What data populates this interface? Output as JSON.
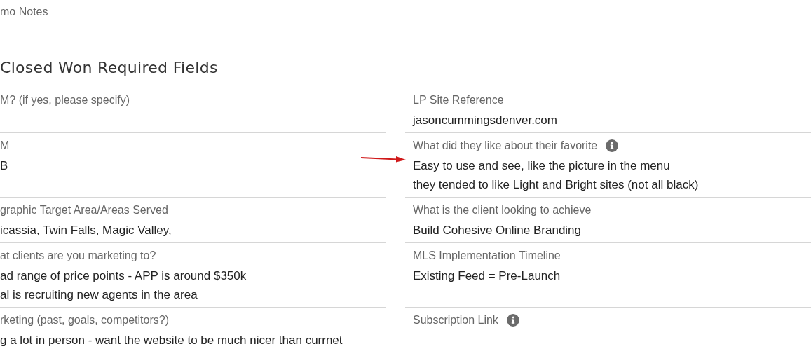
{
  "notes_section": {
    "label": "mo Notes"
  },
  "section_title": "Closed Won Required Fields",
  "rows": [
    {
      "left": {
        "label": "M? (if yes, please specify)"
      },
      "right": {
        "label": "LP Site Reference",
        "values": [
          "jasoncummingsdenver.com"
        ]
      }
    },
    {
      "left": {
        "label": "M",
        "values": [
          "B"
        ]
      },
      "right": {
        "label": "What did they like about their favorite",
        "values": [
          "Easy to use and see, like the picture in the menu",
          "they tended to like Light and Bright sites (not all black)"
        ],
        "info": true,
        "marked": true
      }
    },
    {
      "left": {
        "label": "graphic Target Area/Areas Served",
        "values": [
          "icassia, Twin Falls, Magic Valley,"
        ]
      },
      "right": {
        "label": "What is the client looking to achieve",
        "values": [
          "Build Cohesive Online Branding"
        ]
      }
    },
    {
      "left": {
        "label": "at clients are you marketing to?",
        "values": [
          "ad range of price points - APP is around $350k",
          "al is recruiting new agents in the area"
        ]
      },
      "right": {
        "label": "MLS Implementation Timeline",
        "values": [
          "Existing Feed = Pre-Launch"
        ]
      }
    },
    {
      "left": {
        "label": "rketing (past, goals, competitors?)",
        "values": [
          "g a lot in person - want the website to be much nicer than currnet"
        ]
      },
      "right": {
        "label": "Subscription Link",
        "info": true
      }
    }
  ]
}
